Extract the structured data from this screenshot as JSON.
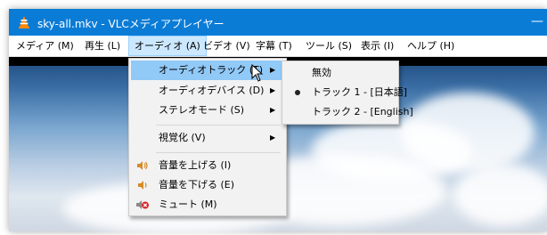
{
  "window": {
    "title": "sky-all.mkv - VLCメディアプレイヤー",
    "minimize_glyph": "—",
    "colors": {
      "titlebar": "#0b7cd6",
      "highlight": "#91c9f7"
    }
  },
  "menubar": {
    "items": [
      {
        "label": "メディア (M)"
      },
      {
        "label": "再生 (L)"
      },
      {
        "label": "オーディオ (A)"
      },
      {
        "label": "ビデオ (V)"
      },
      {
        "label": "字幕 (T)"
      },
      {
        "label": "ツール (S)"
      },
      {
        "label": "表示 (I)"
      },
      {
        "label": "ヘルプ (H)"
      }
    ],
    "active_index": 2
  },
  "audio_menu": {
    "items": [
      {
        "label": "オーディオトラック (T)",
        "submenu": true,
        "highlighted": true
      },
      {
        "label": "オーディオデバイス (D)",
        "submenu": true
      },
      {
        "label": "ステレオモード (S)",
        "submenu": true
      },
      {
        "label": "視覚化 (V)",
        "submenu": true
      },
      {
        "label": "音量を上げる (I)",
        "icon": "volume-up-icon"
      },
      {
        "label": "音量を下げる (E)",
        "icon": "volume-down-icon"
      },
      {
        "label": "ミュート (M)",
        "icon": "mute-icon"
      }
    ]
  },
  "track_submenu": {
    "items": [
      {
        "label": "無効",
        "selected": false
      },
      {
        "label": "トラック 1 - [日本語]",
        "selected": true
      },
      {
        "label": "トラック 2 - [English]",
        "selected": false
      }
    ]
  },
  "submenu_arrow": "▶"
}
